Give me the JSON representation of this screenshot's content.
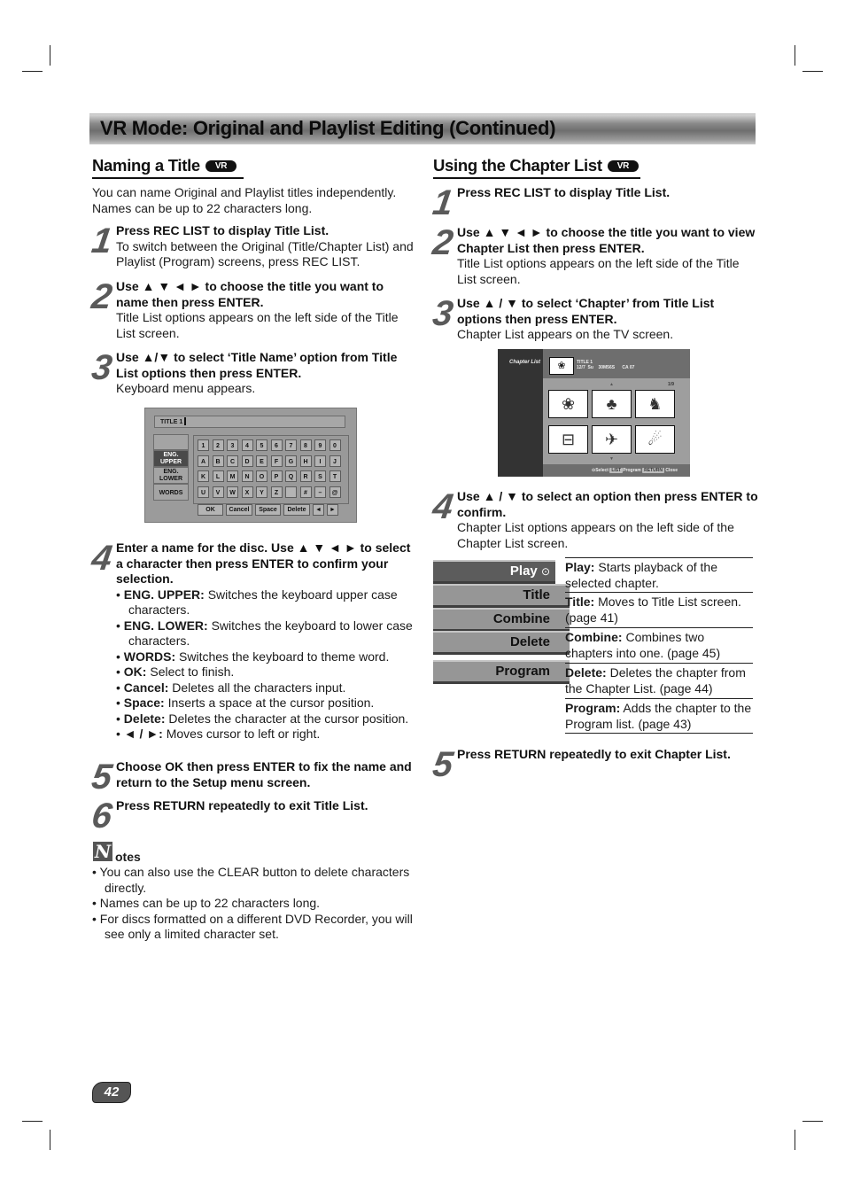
{
  "page": {
    "banner_title": "VR Mode: Original and Playlist Editing (Continued)",
    "page_number": "42"
  },
  "left": {
    "section_title": "Naming a Title",
    "badge": "VR",
    "intro": "You can name Original and Playlist titles independently. Names can be up to 22 characters long.",
    "steps": [
      {
        "num": "1",
        "bold": "Press REC LIST to display Title List.",
        "text": "To switch between the Original (Title/Chapter List) and Playlist (Program) screens, press REC LIST."
      },
      {
        "num": "2",
        "bold": "Use ▲ ▼ ◄ ► to choose the title you want to name then press ENTER.",
        "text": "Title List options appears on the left side of the Title List screen."
      },
      {
        "num": "3",
        "bold": "Use ▲/▼ to select ‘Title Name’ option from Title List options then press ENTER.",
        "text": "Keyboard menu appears."
      },
      {
        "num": "4",
        "bold": "Enter a name for the disc. Use ▲ ▼ ◄ ► to select a character then press ENTER to confirm your selection.",
        "text": ""
      },
      {
        "num": "5",
        "bold": "Choose OK then press ENTER to fix the name and return to the Setup menu screen.",
        "text": ""
      },
      {
        "num": "6",
        "bold": "Press RETURN repeatedly to exit Title List.",
        "text": ""
      }
    ],
    "step4_bullets": [
      {
        "term": "ENG. UPPER:",
        "desc": " Switches the keyboard upper case characters."
      },
      {
        "term": "ENG. LOWER:",
        "desc": " Switches the keyboard to lower case characters."
      },
      {
        "term": "WORDS:",
        "desc": " Switches the keyboard to theme word."
      },
      {
        "term": "OK:",
        "desc": " Select to finish."
      },
      {
        "term": "Cancel:",
        "desc": " Deletes all the characters input."
      },
      {
        "term": "Space:",
        "desc": " Inserts a space at the cursor position."
      },
      {
        "term": "Delete:",
        "desc": " Deletes the character at the cursor position."
      },
      {
        "term": "◄ / ►:",
        "desc": " Moves cursor to left or right."
      }
    ],
    "notes_title": "otes",
    "notes_icon_letter": "N",
    "notes": [
      "You can also use the CLEAR button to delete characters directly.",
      "Names can be up to 22 characters long.",
      "For discs formatted on a different DVD Recorder, you will see only a limited character set."
    ]
  },
  "keyboard_screen": {
    "field_value": "TITLE 1",
    "modes": [
      "",
      "ENG. UPPER",
      "ENG. LOWER",
      "WORDS"
    ],
    "selected_mode": "ENG. UPPER",
    "rows": [
      [
        "1",
        "2",
        "3",
        "4",
        "5",
        "6",
        "7",
        "8",
        "9",
        "0"
      ],
      [
        "A",
        "B",
        "C",
        "D",
        "E",
        "F",
        "G",
        "H",
        "I",
        "J"
      ],
      [
        "K",
        "L",
        "M",
        "N",
        "O",
        "P",
        "Q",
        "R",
        "S",
        "T"
      ],
      [
        "U",
        "V",
        "W",
        "X",
        "Y",
        "Z",
        "",
        "#",
        "–",
        "@"
      ]
    ],
    "buttons": [
      "OK",
      "Cancel",
      "Space",
      "Delete",
      "◄",
      "►"
    ]
  },
  "right": {
    "section_title": "Using the Chapter List",
    "badge": "VR",
    "steps": [
      {
        "num": "1",
        "bold": "Press REC LIST to display Title List.",
        "text": ""
      },
      {
        "num": "2",
        "bold": "Use ▲ ▼ ◄ ► to choose the title you want to view Chapter List then press ENTER.",
        "text": "Title List options appears on the left side of the Title List screen."
      },
      {
        "num": "3",
        "bold": "Use ▲ / ▼ to select ‘Chapter’ from Title List options then press ENTER.",
        "text": "Chapter List appears on the TV screen."
      },
      {
        "num": "4",
        "bold": "Use ▲ / ▼ to select an option then press ENTER to confirm.",
        "text": "Chapter List options appears on the left side of the Chapter List screen."
      },
      {
        "num": "5",
        "bold": "Press RETURN repeatedly to exit Chapter List.",
        "text": ""
      }
    ],
    "menu": [
      {
        "label": "Play",
        "icon": "⊙",
        "selected": true
      },
      {
        "label": "Title",
        "selected": false
      },
      {
        "label": "Combine",
        "selected": false
      },
      {
        "label": "Delete",
        "selected": false
      },
      {
        "label": "Program",
        "selected": false
      }
    ],
    "descriptions": [
      {
        "term": "Play:",
        "desc": " Starts playback of the selected chapter."
      },
      {
        "term": "Title:",
        "desc": " Moves to Title List screen. (page 41)"
      },
      {
        "term": "Combine:",
        "desc": " Combines two chapters into one. (page 45)"
      },
      {
        "term": "Delete:",
        "desc": " Deletes the chapter from the Chapter List. (page 44)"
      },
      {
        "term": "Program:",
        "desc": " Adds the chapter to the Program list. (page 43)"
      }
    ]
  },
  "chapter_screen": {
    "label": "Chapter List",
    "title_info": "TITLE 1\n12/7  Su    30M56S      CA 07",
    "page_indicator": "1/9",
    "thumbnails": [
      "rose-icon",
      "tree-icon",
      "figure-icon",
      "car-icon",
      "shuttle-icon",
      "dancer-icon"
    ],
    "thumb_glyphs": [
      "❀",
      "♣",
      "♞",
      "⊟",
      "✈",
      "☄"
    ],
    "footer_select": "⊙Select",
    "footer_list_tag": "LIST",
    "footer_program": "Program",
    "footer_return_tag": "RETURN",
    "footer_close": "Close"
  }
}
